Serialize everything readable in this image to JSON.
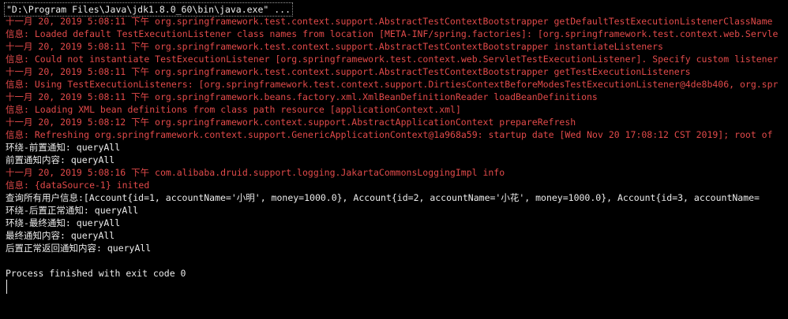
{
  "console": {
    "lines": [
      {
        "text": "\"D:\\Program Files\\Java\\jdk1.8.0_60\\bin\\java.exe\" ...",
        "color": "#ececec",
        "kind": "command"
      },
      {
        "text": "十一月 20, 2019 5:08:11 下午 org.springframework.test.context.support.AbstractTestContextBootstrapper getDefaultTestExecutionListenerClassName",
        "color": "#e24a4a",
        "kind": "log"
      },
      {
        "text": "信息: Loaded default TestExecutionListener class names from location [META-INF/spring.factories]: [org.springframework.test.context.web.Servle",
        "color": "#e24a4a",
        "kind": "log"
      },
      {
        "text": "十一月 20, 2019 5:08:11 下午 org.springframework.test.context.support.AbstractTestContextBootstrapper instantiateListeners",
        "color": "#e24a4a",
        "kind": "log"
      },
      {
        "text": "信息: Could not instantiate TestExecutionListener [org.springframework.test.context.web.ServletTestExecutionListener]. Specify custom listener",
        "color": "#e24a4a",
        "kind": "log"
      },
      {
        "text": "十一月 20, 2019 5:08:11 下午 org.springframework.test.context.support.AbstractTestContextBootstrapper getTestExecutionListeners",
        "color": "#e24a4a",
        "kind": "log"
      },
      {
        "text": "信息: Using TestExecutionListeners: [org.springframework.test.context.support.DirtiesContextBeforeModesTestExecutionListener@4de8b406, org.spr",
        "color": "#e24a4a",
        "kind": "log"
      },
      {
        "text": "十一月 20, 2019 5:08:11 下午 org.springframework.beans.factory.xml.XmlBeanDefinitionReader loadBeanDefinitions",
        "color": "#e24a4a",
        "kind": "log"
      },
      {
        "text": "信息: Loading XML bean definitions from class path resource [applicationContext.xml]",
        "color": "#e24a4a",
        "kind": "log"
      },
      {
        "text": "十一月 20, 2019 5:08:12 下午 org.springframework.context.support.AbstractApplicationContext prepareRefresh",
        "color": "#e24a4a",
        "kind": "log"
      },
      {
        "text": "信息: Refreshing org.springframework.context.support.GenericApplicationContext@1a968a59: startup date [Wed Nov 20 17:08:12 CST 2019]; root of",
        "color": "#e24a4a",
        "kind": "log"
      },
      {
        "text": "环绕-前置通知: queryAll",
        "color": "#ececec",
        "kind": "output"
      },
      {
        "text": "前置通知内容: queryAll",
        "color": "#ececec",
        "kind": "output"
      },
      {
        "text": "十一月 20, 2019 5:08:16 下午 com.alibaba.druid.support.logging.JakartaCommonsLoggingImpl info",
        "color": "#e24a4a",
        "kind": "log"
      },
      {
        "text": "信息: {dataSource-1} inited",
        "color": "#e24a4a",
        "kind": "log"
      },
      {
        "text": "查询所有用户信息:[Account{id=1, accountName='小明', money=1000.0}, Account{id=2, accountName='小花', money=1000.0}, Account{id=3, accountName=",
        "color": "#ececec",
        "kind": "output"
      },
      {
        "text": "环绕-后置正常通知: queryAll",
        "color": "#ececec",
        "kind": "output"
      },
      {
        "text": "环绕-最终通知: queryAll",
        "color": "#ececec",
        "kind": "output"
      },
      {
        "text": "最终通知内容: queryAll",
        "color": "#ececec",
        "kind": "output"
      },
      {
        "text": "后置正常返回通知内容: queryAll",
        "color": "#ececec",
        "kind": "output"
      },
      {
        "text": "",
        "color": "#ececec",
        "kind": "blank"
      },
      {
        "text": "Process finished with exit code 0",
        "color": "#ececec",
        "kind": "output"
      }
    ]
  },
  "colors": {
    "background": "#000000",
    "log_text": "#e24a4a",
    "stdout_text": "#ececec"
  }
}
